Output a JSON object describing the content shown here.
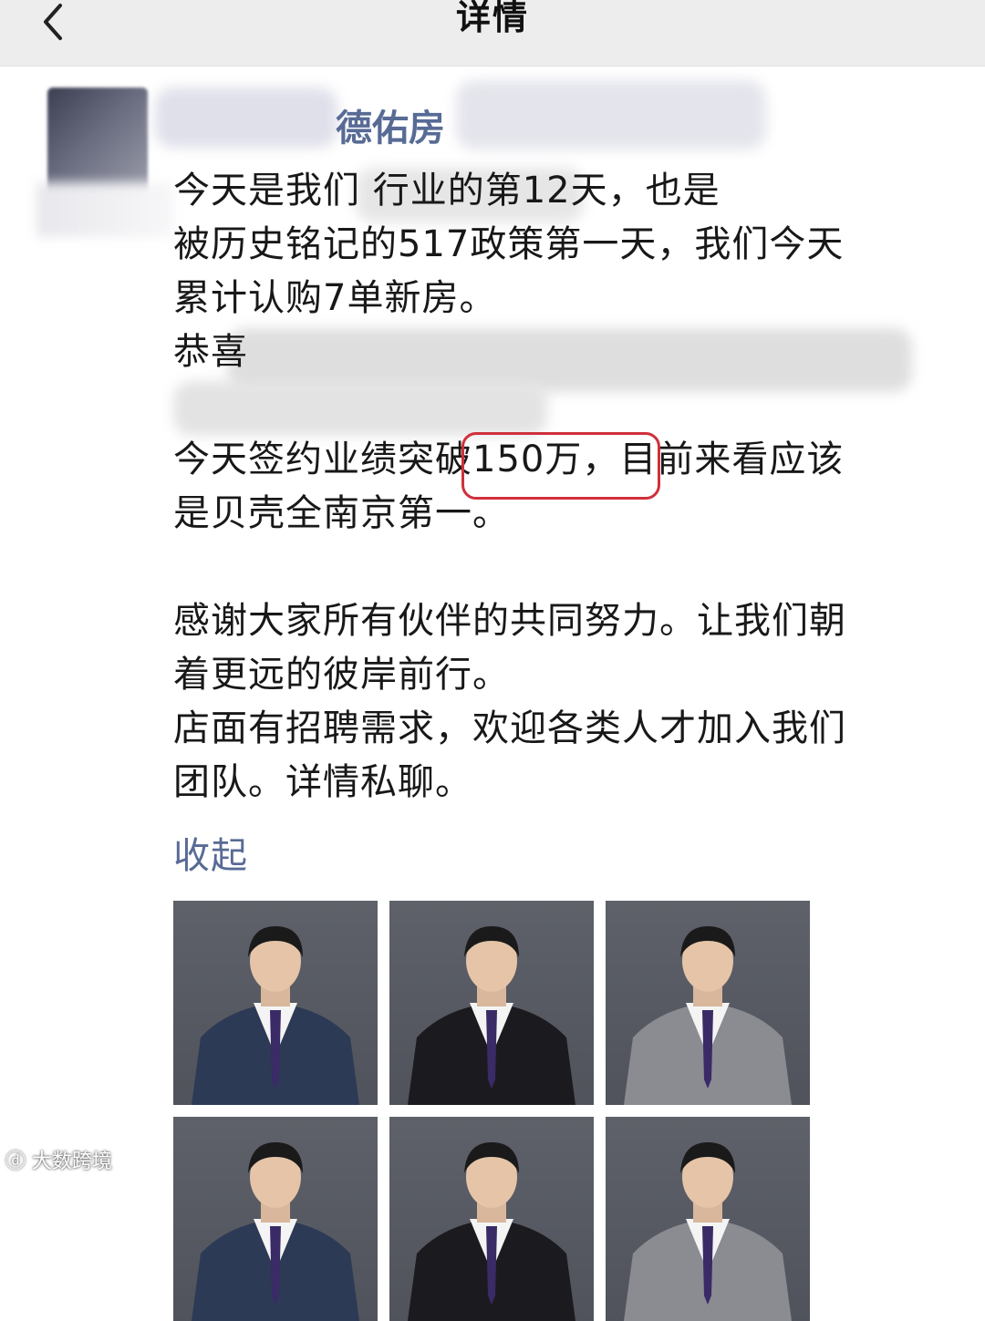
{
  "topbar": {
    "title": "详情",
    "back_icon": "chevron-left-icon"
  },
  "post": {
    "author_visible": "德佑房",
    "lines": [
      "今天是我们                      行业的第12天，也是",
      "被历史铭记的517政策第一天，我们今天",
      "累计认购7单新房。",
      "恭喜",
      "",
      "今天签约业绩突破150万，目前来看应该",
      "是贝壳全南京第一。",
      "",
      "感谢大家所有伙伴的共同努力。让我们朝",
      "着更远的彼岸前行。",
      "店面有招聘需求，欢迎各类人才加入我们",
      "团队。详情私聊。"
    ],
    "highlight_text": "破150万，",
    "collapse_label": "收起"
  },
  "photos": {
    "count_visible": 6,
    "suit_colors": [
      "#2c3a55",
      "#1b1b1f",
      "#8a8c92",
      "#2c3a55",
      "#1b1b1f",
      "#8a8c92"
    ]
  },
  "watermark": "大数跨境",
  "colors": {
    "link": "#576b95",
    "highlight_border": "#d0303b",
    "topbar_bg": "#ededed"
  }
}
